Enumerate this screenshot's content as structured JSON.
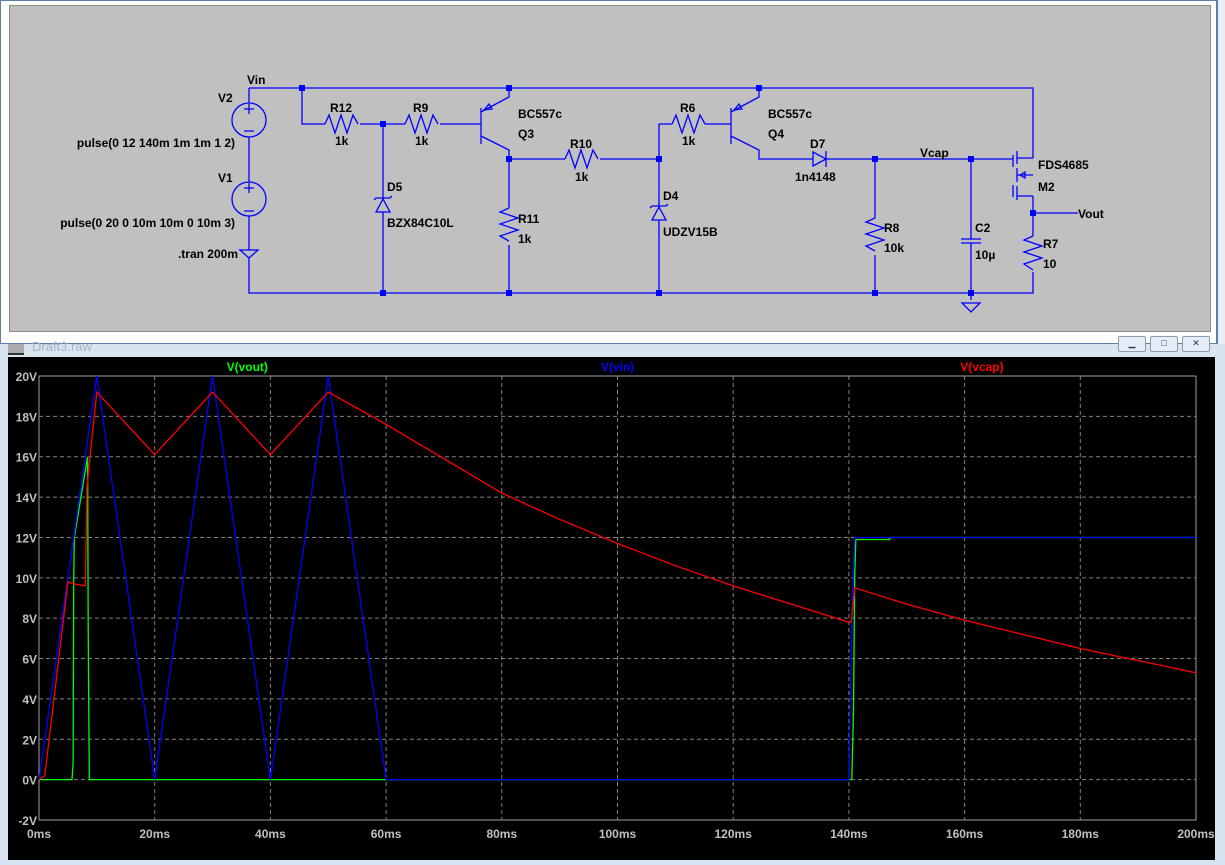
{
  "schematic": {
    "nets": {
      "vin": "Vin",
      "vcap": "Vcap",
      "vout": "Vout"
    },
    "components": {
      "V2": {
        "name": "V2",
        "value": "pulse(0 12 140m 1m 1m 1 2)"
      },
      "V1": {
        "name": "V1",
        "value": "pulse(0 20 0 10m 10m 0 10m 3)"
      },
      "directive": ".tran 200m",
      "R12": {
        "name": "R12",
        "value": "1k"
      },
      "R9": {
        "name": "R9",
        "value": "1k"
      },
      "D5": {
        "name": "D5",
        "value": "BZX84C10L"
      },
      "Q3": {
        "name": "Q3",
        "value": "BC557c"
      },
      "R10": {
        "name": "R10",
        "value": "1k"
      },
      "R11": {
        "name": "R11",
        "value": "1k"
      },
      "D4": {
        "name": "D4",
        "value": "UDZV15B"
      },
      "R6": {
        "name": "R6",
        "value": "1k"
      },
      "Q4": {
        "name": "Q4",
        "value": "BC557c"
      },
      "D7": {
        "name": "D7",
        "value": "1n4148"
      },
      "R8": {
        "name": "R8",
        "value": "10k"
      },
      "C2": {
        "name": "C2",
        "value": "10µ"
      },
      "M2": {
        "name": "M2",
        "value": "FDS4685"
      },
      "R7": {
        "name": "R7",
        "value": "10"
      }
    }
  },
  "plot_window": {
    "title": "Draft3.raw"
  },
  "chart_data": {
    "type": "line",
    "title": "",
    "xlabel": "",
    "ylabel": "",
    "xlim": [
      0,
      200
    ],
    "ylim": [
      -2,
      20
    ],
    "x_ticks": [
      0,
      20,
      40,
      60,
      80,
      100,
      120,
      140,
      160,
      180,
      200
    ],
    "x_tick_labels": [
      "0ms",
      "20ms",
      "40ms",
      "60ms",
      "80ms",
      "100ms",
      "120ms",
      "140ms",
      "160ms",
      "180ms",
      "200ms"
    ],
    "y_ticks": [
      -2,
      0,
      2,
      4,
      6,
      8,
      10,
      12,
      14,
      16,
      18,
      20
    ],
    "y_tick_labels": [
      "-2V",
      "0V",
      "2V",
      "4V",
      "6V",
      "8V",
      "10V",
      "12V",
      "14V",
      "16V",
      "18V",
      "20V"
    ],
    "grid": true,
    "legend_placement": "top",
    "series": [
      {
        "name": "V(vout)",
        "color": "#00ff00",
        "points": [
          [
            0,
            0
          ],
          [
            5.7,
            0
          ],
          [
            5.9,
            0.8
          ],
          [
            6,
            9.8
          ],
          [
            6.1,
            12
          ],
          [
            8.4,
            16
          ],
          [
            8.5,
            7.5
          ],
          [
            8.7,
            0
          ],
          [
            140.5,
            0
          ],
          [
            140.8,
            3.5
          ],
          [
            141,
            10
          ],
          [
            141.2,
            11.9
          ],
          [
            147,
            11.9
          ],
          [
            147.2,
            12
          ],
          [
            200,
            12
          ]
        ]
      },
      {
        "name": "V(vin)",
        "color": "#0000ff",
        "points": [
          [
            0,
            0
          ],
          [
            10,
            20
          ],
          [
            20,
            0
          ],
          [
            30,
            20
          ],
          [
            40,
            0
          ],
          [
            50,
            20
          ],
          [
            60,
            0
          ],
          [
            140,
            0
          ],
          [
            140.2,
            3.5
          ],
          [
            140.6,
            9
          ],
          [
            141,
            12
          ],
          [
            200,
            12
          ]
        ]
      },
      {
        "name": "V(vcap)",
        "color": "#ff0000",
        "points": [
          [
            0,
            0
          ],
          [
            1,
            0.2
          ],
          [
            5,
            9.8
          ],
          [
            6,
            9.7
          ],
          [
            8,
            9.6
          ],
          [
            8.3,
            14.5
          ],
          [
            9,
            16.5
          ],
          [
            10,
            19.2
          ],
          [
            20,
            16.1
          ],
          [
            20.3,
            16.2
          ],
          [
            30,
            19.2
          ],
          [
            40,
            16.1
          ],
          [
            40.3,
            16.2
          ],
          [
            50,
            19.2
          ],
          [
            60,
            17.6
          ],
          [
            70,
            15.9
          ],
          [
            80,
            14.2
          ],
          [
            90,
            12.9
          ],
          [
            100,
            11.7
          ],
          [
            110,
            10.6
          ],
          [
            120,
            9.6
          ],
          [
            130,
            8.7
          ],
          [
            140,
            7.8
          ],
          [
            140.4,
            7.8
          ],
          [
            141,
            9.5
          ],
          [
            150,
            8.7
          ],
          [
            160,
            7.9
          ],
          [
            170,
            7.2
          ],
          [
            180,
            6.5
          ],
          [
            190,
            5.9
          ],
          [
            200,
            5.3
          ]
        ]
      }
    ]
  }
}
